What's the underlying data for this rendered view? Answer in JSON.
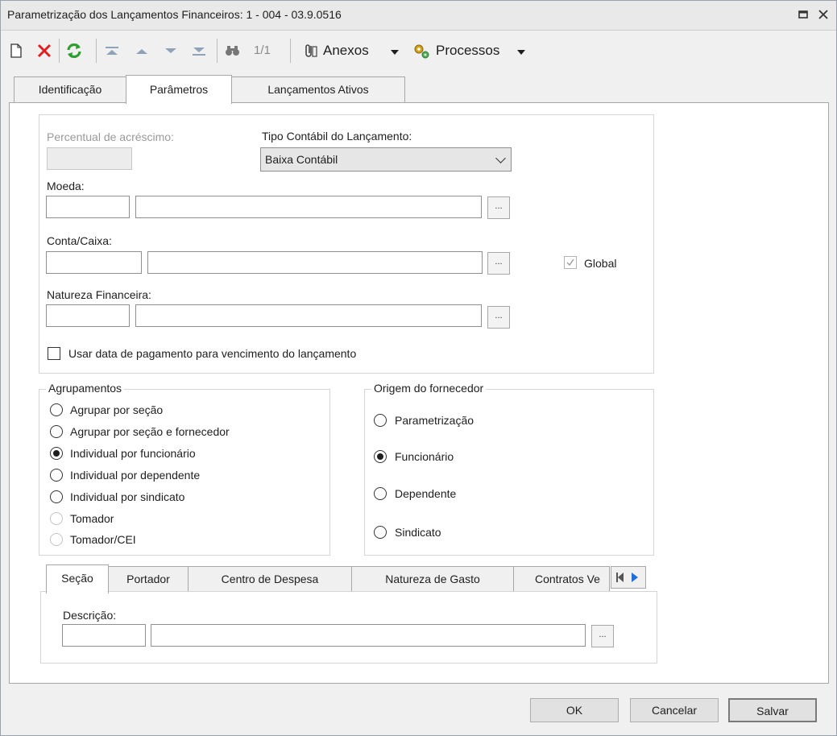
{
  "window": {
    "title": "Parametrização dos Lançamentos Financeiros: 1 - 004 - 03.9.0516",
    "controls": [
      "restore-icon",
      "close-icon"
    ]
  },
  "toolbar": {
    "new_icon": "new-document-icon",
    "delete_icon": "delete-x-icon",
    "refresh_icon": "refresh-icon",
    "nav": [
      "first-record-icon",
      "previous-record-icon",
      "next-record-icon",
      "last-record-icon"
    ],
    "search_icon": "binoculars-icon",
    "record_counter": "1/1",
    "attachments_label": "Anexos",
    "processes_label": "Processos"
  },
  "tabs": [
    {
      "label": "Identificação",
      "active": false
    },
    {
      "label": "Parâmetros",
      "active": true
    },
    {
      "label": "Lançamentos Ativos",
      "active": false
    }
  ],
  "form": {
    "percentual_label": "Percentual de acréscimo:",
    "percentual_value": "",
    "tipo_contabil_label": "Tipo Contábil do Lançamento:",
    "tipo_contabil_value": "Baixa Contábil",
    "moeda_label": "Moeda:",
    "conta_caixa_label": "Conta/Caixa:",
    "global_label": "Global",
    "global_checked": true,
    "natureza_label": "Natureza Financeira:",
    "lookup_label": "...",
    "usar_data_label": "Usar data de pagamento para vencimento do lançamento",
    "usar_data_checked": false
  },
  "agrupamentos": {
    "title": "Agrupamentos",
    "options": [
      {
        "label": "Agrupar por seção",
        "selected": false,
        "enabled": true
      },
      {
        "label": "Agrupar por seção e fornecedor",
        "selected": false,
        "enabled": true
      },
      {
        "label": "Individual por funcionário",
        "selected": true,
        "enabled": true
      },
      {
        "label": "Individual por dependente",
        "selected": false,
        "enabled": true
      },
      {
        "label": "Individual por sindicato",
        "selected": false,
        "enabled": true
      },
      {
        "label": "Tomador",
        "selected": false,
        "enabled": false
      },
      {
        "label": "Tomador/CEI",
        "selected": false,
        "enabled": false
      }
    ]
  },
  "origem": {
    "title": "Origem do fornecedor",
    "options": [
      {
        "label": "Parametrização",
        "selected": false
      },
      {
        "label": "Funcionário",
        "selected": true
      },
      {
        "label": "Dependente",
        "selected": false
      },
      {
        "label": "Sindicato",
        "selected": false
      }
    ]
  },
  "subtabs": [
    {
      "label": "Seção",
      "active": true
    },
    {
      "label": "Portador",
      "active": false
    },
    {
      "label": "Centro de Despesa",
      "active": false
    },
    {
      "label": "Natureza de Gasto",
      "active": false
    },
    {
      "label": "Contratos Ve",
      "active": false
    }
  ],
  "subtab_nav_icons": [
    "tab-scroll-left-icon",
    "tab-scroll-right-icon"
  ],
  "secao": {
    "descricao_label": "Descrição:"
  },
  "buttons": {
    "ok": "OK",
    "cancel": "Cancelar",
    "save": "Salvar"
  },
  "colors": {
    "delete_red": "#e02020",
    "refresh_green": "#2e9e2e",
    "nav_arrow": "#8ea3b8",
    "tab_scroll_blue": "#1e6fd9"
  }
}
